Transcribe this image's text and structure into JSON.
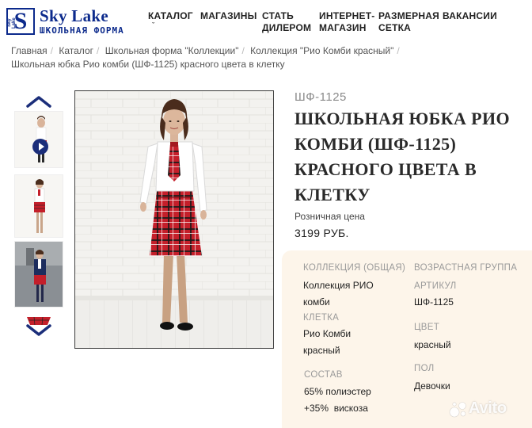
{
  "brand": {
    "mark": "S",
    "mark_side": "Sky Lake",
    "name": "Sky Lake",
    "tagline": "ШКОЛЬНАЯ ФОРМА",
    "color": "#0c2a8c"
  },
  "nav": {
    "items": [
      {
        "line1": "КАТАЛОГ",
        "line2": "ˇ"
      },
      {
        "line1": "МАГАЗИНЫ",
        "line2": ""
      },
      {
        "line1": "СТАТЬ",
        "line2": "ДИЛЕРОМ"
      },
      {
        "line1": "ИНТЕРНЕТ-",
        "line2": "МАГАЗИН"
      },
      {
        "line1": "РАЗМЕРНАЯ",
        "line2": "СЕТКА"
      },
      {
        "line1": "ВАКАНСИИ",
        "line2": ""
      }
    ]
  },
  "breadcrumb": {
    "items": [
      "Главная",
      "Каталог",
      "Школьная форма \"Коллекции\"",
      "Коллекция \"Рио Комби красный\"",
      "Школьная юбка Рио комби (ШФ-1125) красного цвета в клетку"
    ],
    "separator": "/"
  },
  "gallery": {
    "thumb_icons": [
      "play-icon"
    ],
    "arrow_icons": [
      "chevron-up-icon",
      "chevron-down-icon"
    ]
  },
  "product": {
    "sku_heading": "ШФ-1125",
    "title": "ШКОЛЬНАЯ ЮБКА РИО КОМБИ (ШФ-1125) КРАСНОГО ЦВЕТА В КЛЕТКУ",
    "price_label": "Розничная цена",
    "price": "3199 РУБ."
  },
  "specs": {
    "collection_label": "КОЛЛЕКЦИЯ (ОБЩАЯ)",
    "collection_value_1": "Коллекция РИО",
    "collection_value_2": "комби",
    "age_label": "ВОЗРАСТНАЯ ГРУППА",
    "article_label": "АРТИКУЛ",
    "article_value": "ШФ-1125",
    "check_label": "КЛЕТКА",
    "check_value_1": "Рио Комби",
    "check_value_2": "красный",
    "color_label": "ЦВЕТ",
    "color_value": "красный",
    "composition_label": "СОСТАВ",
    "composition_line_1": "65% полиэстер",
    "composition_line_2": "+35%  вискоза",
    "gender_label": "ПОЛ",
    "gender_value": "Девочки"
  },
  "watermark": {
    "text": "Avito"
  },
  "colors": {
    "accent_red": "#c8202b",
    "navy": "#0c2a8c",
    "spec_bg": "#fdf5ea"
  }
}
